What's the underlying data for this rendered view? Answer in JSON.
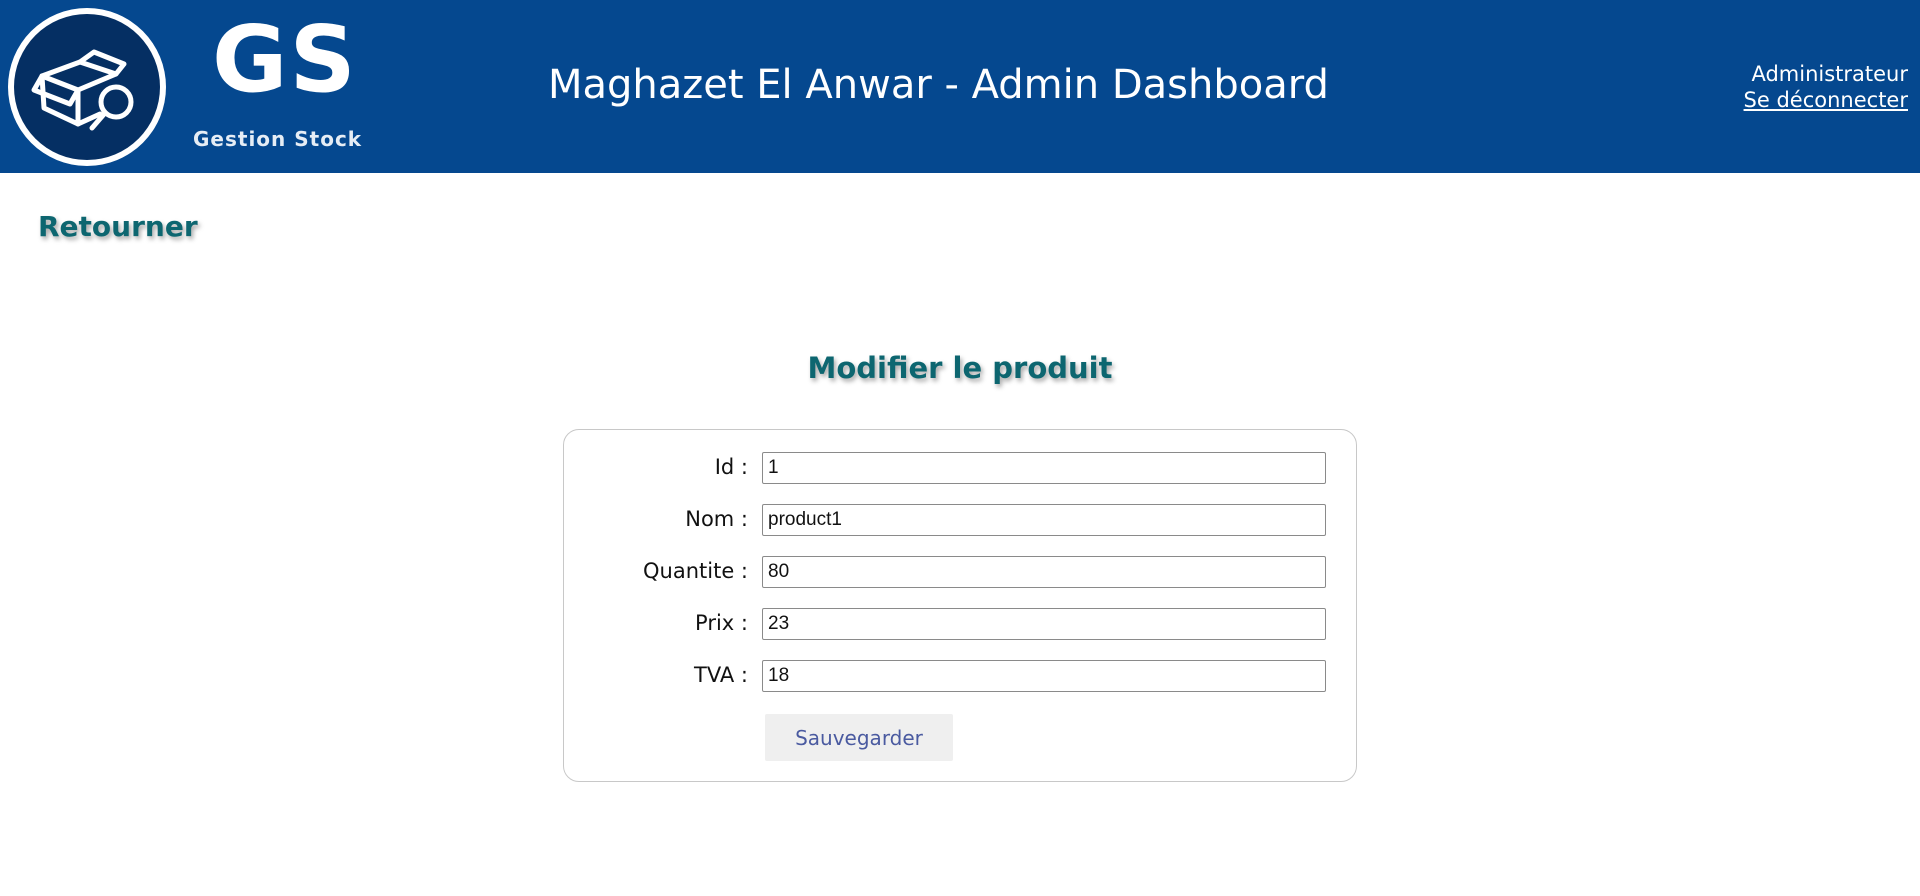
{
  "header": {
    "logo_text": "GS",
    "logo_subtitle": "Gestion Stock",
    "logo_icon": "box-search-icon",
    "title": "Maghazet El Anwar - Admin Dashboard",
    "user_role": "Administrateur",
    "logout_label": "Se déconnecter"
  },
  "nav": {
    "back_label": "Retourner"
  },
  "form": {
    "title": "Modifier le produit",
    "fields": [
      {
        "label": "Id :",
        "value": "1"
      },
      {
        "label": "Nom :",
        "value": "product1"
      },
      {
        "label": "Quantite :",
        "value": "80"
      },
      {
        "label": "Prix :",
        "value": "23"
      },
      {
        "label": "TVA :",
        "value": "18"
      }
    ],
    "submit_label": "Sauvegarder"
  },
  "colors": {
    "header_bg": "#05488f",
    "accent_teal": "#0d6670"
  }
}
